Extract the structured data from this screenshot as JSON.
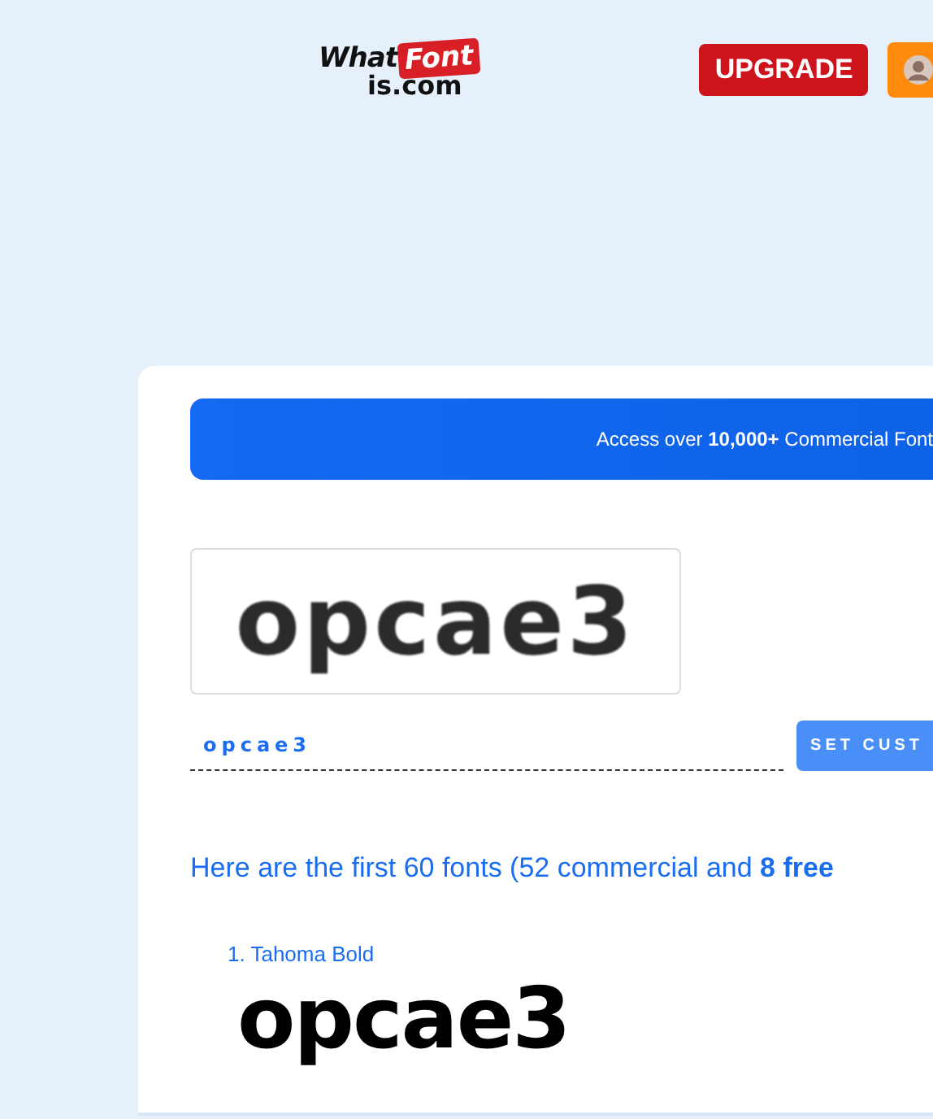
{
  "header": {
    "logo": {
      "word_1": "What",
      "word_2": "Font",
      "word_3": "is.com"
    },
    "upgrade_button": "UPGRADE"
  },
  "banner": {
    "text": "Access over **10,000+** Commercial Font"
  },
  "sample": {
    "image_text": "opcae3",
    "input_value": "opcae3",
    "button": "SET CUST"
  },
  "results_heading": "Here are the first 60 fonts (52 commercial and **8 free**",
  "results": [
    {
      "name": "1. Tahoma Bold",
      "preview": "opcae3"
    }
  ]
}
